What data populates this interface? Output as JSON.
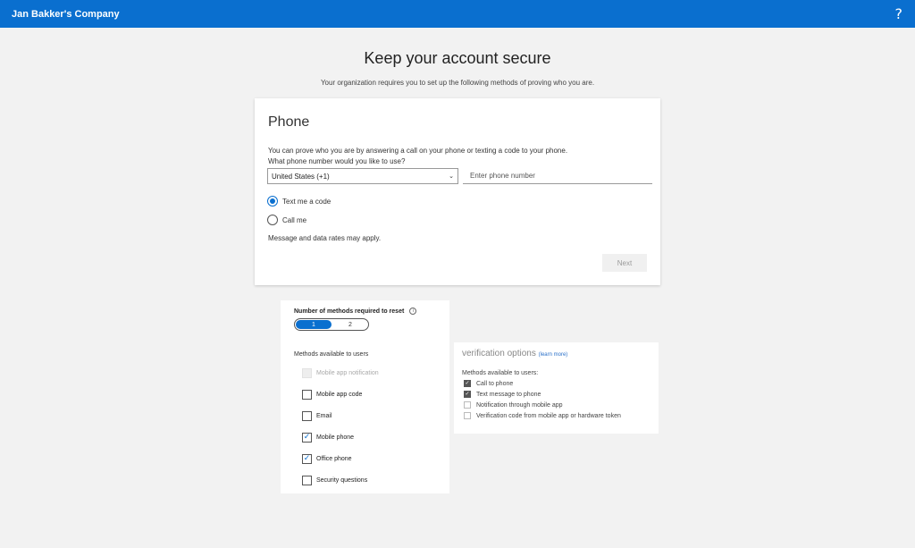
{
  "header": {
    "company": "Jan Bakker's Company",
    "help_label": "?"
  },
  "page": {
    "title": "Keep your account secure",
    "subtitle": "Your organization requires you to set up the following methods of proving who you are."
  },
  "phone_card": {
    "heading": "Phone",
    "intro": "You can prove who you are by answering a call on your phone or texting a code to your phone.",
    "question": "What phone number would you like to use?",
    "country": "United States (+1)",
    "phone_value": "",
    "phone_placeholder": "Enter phone number",
    "options": [
      {
        "label": "Text me a code",
        "selected": true
      },
      {
        "label": "Call me",
        "selected": false
      }
    ],
    "rates_note": "Message and data rates may apply.",
    "next_label": "Next"
  },
  "methods_panel": {
    "required_label": "Number of methods required to reset",
    "info_icon": "i",
    "toggle": [
      "1",
      "2"
    ],
    "toggle_selected": "1",
    "available_label": "Methods available to users",
    "methods": [
      {
        "label": "Mobile app notification",
        "checked": false,
        "disabled": true
      },
      {
        "label": "Mobile app code",
        "checked": false,
        "disabled": false
      },
      {
        "label": "Email",
        "checked": false,
        "disabled": false
      },
      {
        "label": "Mobile phone",
        "checked": true,
        "disabled": false
      },
      {
        "label": "Office phone",
        "checked": true,
        "disabled": false
      },
      {
        "label": "Security questions",
        "checked": false,
        "disabled": false
      }
    ]
  },
  "verification_panel": {
    "title": "verification options",
    "learn_more": "(learn more)",
    "available_label": "Methods available to users:",
    "options": [
      {
        "label": "Call to phone",
        "checked": true
      },
      {
        "label": "Text message to phone",
        "checked": true
      },
      {
        "label": "Notification through mobile app",
        "checked": false
      },
      {
        "label": "Verification code from mobile app or hardware token",
        "checked": false
      }
    ]
  },
  "colors": {
    "accent": "#0a6fcf",
    "background": "#f2f2f2"
  },
  "icons": {
    "help": "help-icon",
    "dropdown": "chevron-down-icon",
    "info": "info-icon",
    "check": "checkmark-icon"
  }
}
